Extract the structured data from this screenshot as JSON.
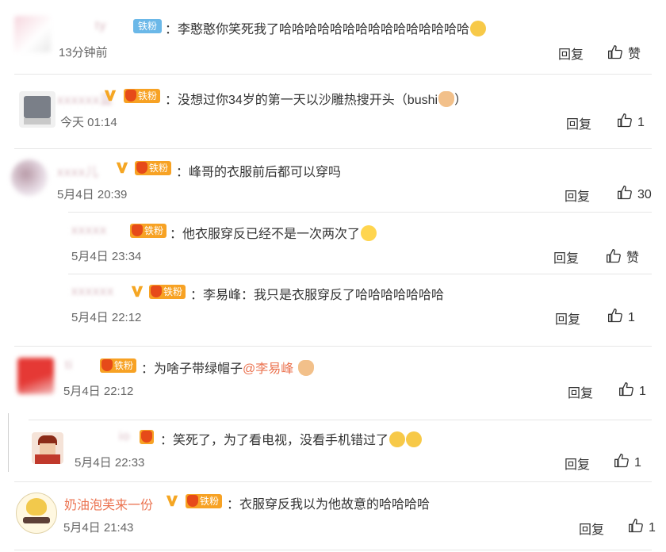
{
  "comments": [
    {
      "user": "ty",
      "badge": "铁粉",
      "text": "：李憨憨你笑死我了哈哈哈哈哈哈哈哈哈哈哈哈哈哈哈",
      "time": "13分钟前",
      "reply": "回复",
      "like": "赞"
    },
    {
      "user": "蓝",
      "badge": "铁粉",
      "text": "：没想过你34岁的第一天以沙雕热搜开头（bushi",
      "text_end": "）",
      "time": "今天 01:14",
      "reply": "回复",
      "like": "1"
    },
    {
      "user": "儿",
      "badge": "铁粉",
      "text": "：峰哥的衣服前后都可以穿吗",
      "time": "5月4日 20:39",
      "reply": "回复",
      "like": "30"
    },
    {
      "user": "",
      "badge": "铁粉",
      "text": "：他衣服穿反已经不是一次两次了",
      "time": "5月4日 23:34",
      "reply": "回复",
      "like": "赞"
    },
    {
      "user": "",
      "badge": "铁粉",
      "text": "：李易峰：我只是衣服穿反了哈哈哈哈哈哈哈",
      "time": "5月4日 22:12",
      "reply": "回复",
      "like": "1"
    },
    {
      "user": "ti",
      "badge": "铁粉",
      "text": "：为啥子带绿帽子",
      "mention": "@李易峰",
      "time": "5月4日 22:12",
      "reply": "回复",
      "like": "1"
    },
    {
      "user": "io",
      "text": "：笑死了，为了看电视，没看手机错过了",
      "time": "5月4日 22:33",
      "reply": "回复",
      "like": "1"
    },
    {
      "user": "奶油泡芙来一份",
      "badge": "铁粉",
      "text": "：衣服穿反我以为他故意的哈哈哈哈",
      "time": "5月4日 21:43",
      "reply": "回复",
      "like": "1"
    }
  ],
  "colors": {
    "username": "#eb7350",
    "badge": "#f7a224",
    "text": "#333333",
    "time": "#666666",
    "divider": "#e6e6e6"
  },
  "icons": {
    "like": "thumbs-up-icon",
    "vip": "v-badge-icon",
    "emoji": "emoji-icon"
  }
}
